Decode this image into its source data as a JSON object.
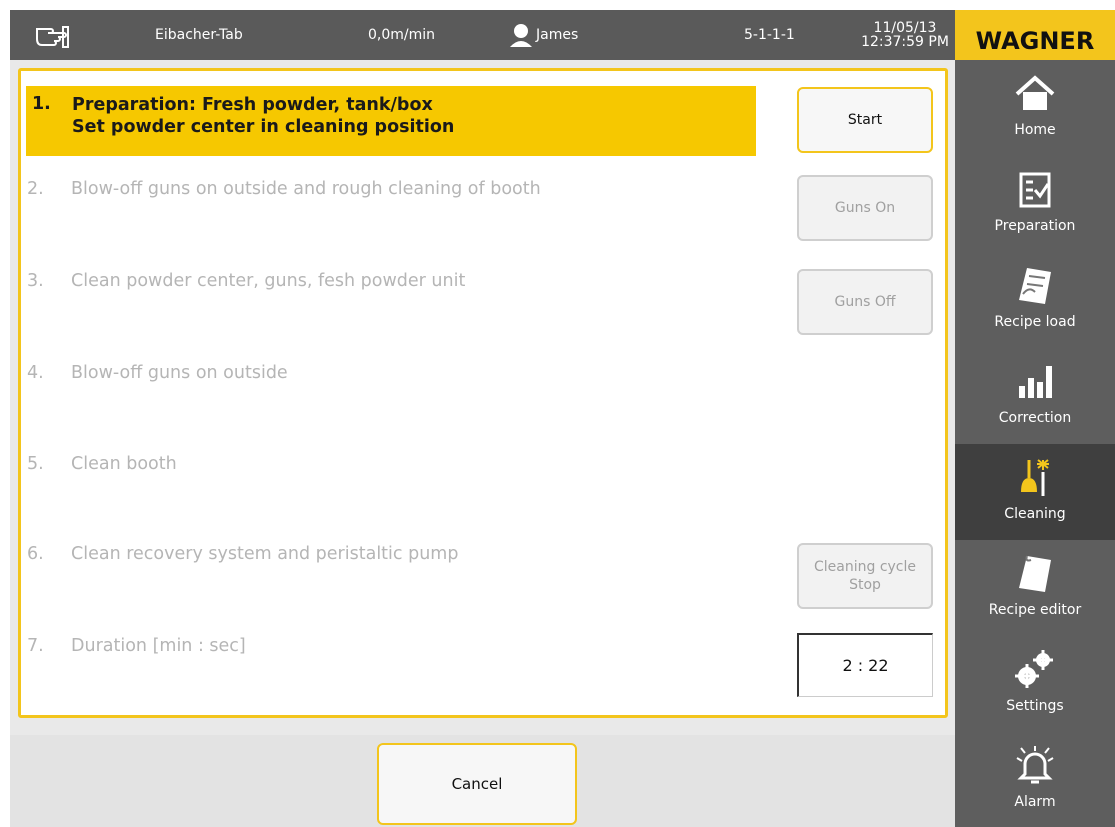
{
  "topbar": {
    "station": "Eibacher-Tab",
    "speed": "0,0m/min",
    "user": "James",
    "code": "5-1-1-1",
    "date": "11/05/13",
    "time": "12:37:59 PM"
  },
  "brand": {
    "logo_text": "WAGNER",
    "accent_color": "#f3c51c"
  },
  "steps": [
    {
      "num": "1.",
      "line1": "Preparation: Fresh powder, tank/box",
      "line2": "Set powder center in cleaning position",
      "active": true
    },
    {
      "num": "2.",
      "line1": "Blow-off guns on outside and rough cleaning of booth"
    },
    {
      "num": "3.",
      "line1": "Clean powder center, guns, fesh powder unit"
    },
    {
      "num": "4.",
      "line1": "Blow-off guns on outside"
    },
    {
      "num": "5.",
      "line1": "Clean booth"
    },
    {
      "num": "6.",
      "line1": "Clean recovery system and peristaltic pump"
    },
    {
      "num": "7.",
      "line1": "Duration [min : sec]"
    }
  ],
  "buttons": {
    "start": "Start",
    "guns_on": "Guns On",
    "guns_off": "Guns Off",
    "cleaning_cycle_line1": "Cleaning cycle",
    "cleaning_cycle_line2": "Stop",
    "cancel": "Cancel"
  },
  "duration_value": "2 : 22",
  "sidebar": {
    "items": [
      {
        "label": "Home",
        "icon": "home-icon"
      },
      {
        "label": "Preparation",
        "icon": "checklist-icon"
      },
      {
        "label": "Recipe load",
        "icon": "recipe-load-icon"
      },
      {
        "label": "Correction",
        "icon": "bar-chart-icon"
      },
      {
        "label": "Cleaning",
        "icon": "broom-icon",
        "active": true
      },
      {
        "label": "Recipe editor",
        "icon": "notepad-icon"
      },
      {
        "label": "Settings",
        "icon": "gears-icon"
      },
      {
        "label": "Alarm",
        "icon": "bell-icon"
      }
    ]
  }
}
